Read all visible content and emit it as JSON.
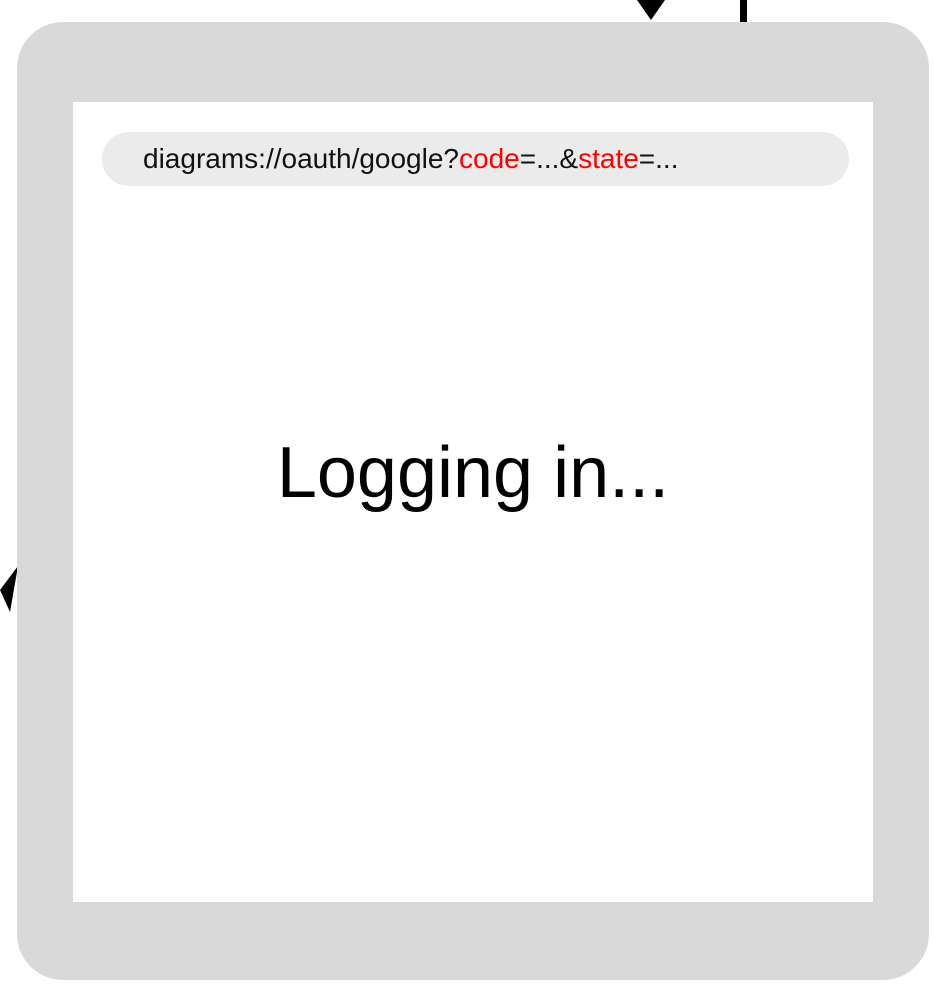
{
  "url": {
    "base": "diagrams://oauth/google?",
    "param1_key": "code",
    "param1_rest": "=...&",
    "param2_key": "state",
    "param2_rest": "=...",
    "highlight_color": "#ff0000"
  },
  "screen": {
    "message": "Logging in..."
  },
  "colors": {
    "device_frame": "#d9d9d9",
    "url_bar": "#ebebeb",
    "arrows": "#000000"
  }
}
